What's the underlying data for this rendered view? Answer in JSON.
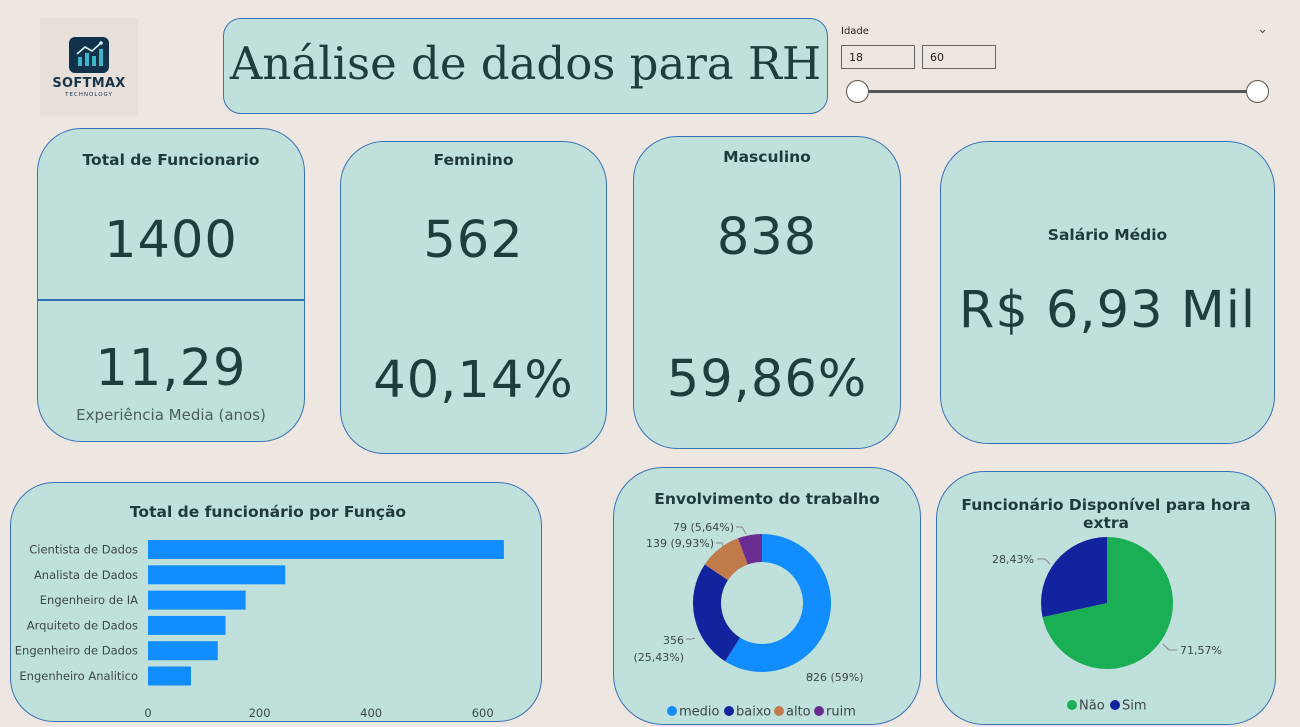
{
  "logo": {
    "name": "SOFTMAX",
    "tagline": "TECHNOLOGY"
  },
  "header": {
    "title": "Análise de dados para RH"
  },
  "filter": {
    "label": "Idade",
    "min_value": "18",
    "max_value": "60",
    "range": [
      18,
      60
    ]
  },
  "kpis": {
    "total": {
      "title": "Total de Funcionario",
      "value": "1400",
      "experience": "11,29",
      "experience_label": "Experiência Media (anos)"
    },
    "female": {
      "title": "Feminino",
      "count": "562",
      "percent": "40,14%"
    },
    "male": {
      "title": "Masculino",
      "count": "838",
      "percent": "59,86%"
    },
    "salary": {
      "title": "Salário Médio",
      "value": "R$ 6,93 Mil"
    }
  },
  "colors": {
    "card_bg": "#c0e0dc",
    "card_border": "#3a72b8",
    "bar": "#118dff",
    "medio": "#118dff",
    "baixo": "#12239e",
    "alto": "#c07a4c",
    "ruim": "#6b2c91",
    "nao": "#1aaf54",
    "sim": "#12239e"
  },
  "chart_data": [
    {
      "type": "bar",
      "orientation": "horizontal",
      "title": "Total de funcionário por Função",
      "categories": [
        "Cientista de Dados",
        "Analista de Dados",
        "Engenheiro de IA",
        "Arquiteto de Dados",
        "Engenheiro de Dados",
        "Engenheiro Analitico"
      ],
      "values": [
        638,
        246,
        175,
        139,
        125,
        77
      ],
      "xlim": [
        0,
        640
      ],
      "xticks": [
        0,
        200,
        400,
        600
      ],
      "grid": false
    },
    {
      "type": "pie",
      "donut": true,
      "title": "Envolvimento do trabalho",
      "slices": [
        {
          "name": "medio",
          "value": 826,
          "label": "826 (59%)",
          "color": "#118dff"
        },
        {
          "name": "baixo",
          "value": 356,
          "label_line1": "356",
          "label_line2": "(25,43%)",
          "color": "#12239e"
        },
        {
          "name": "alto",
          "value": 139,
          "label": "139 (9,93%)",
          "color": "#c07a4c"
        },
        {
          "name": "ruim",
          "value": 79,
          "label": "79 (5,64%)",
          "color": "#6b2c91"
        }
      ],
      "legend": [
        "medio",
        "baixo",
        "alto",
        "ruim"
      ],
      "legend_position": "bottom"
    },
    {
      "type": "pie",
      "title": "Funcionário Disponível para hora extra",
      "slices": [
        {
          "name": "Não",
          "value": 71.57,
          "label": "71,57%",
          "color": "#1aaf54"
        },
        {
          "name": "Sim",
          "value": 28.43,
          "label": "28,43%",
          "color": "#12239e"
        }
      ],
      "legend": [
        "Não",
        "Sim"
      ],
      "legend_position": "bottom"
    }
  ]
}
